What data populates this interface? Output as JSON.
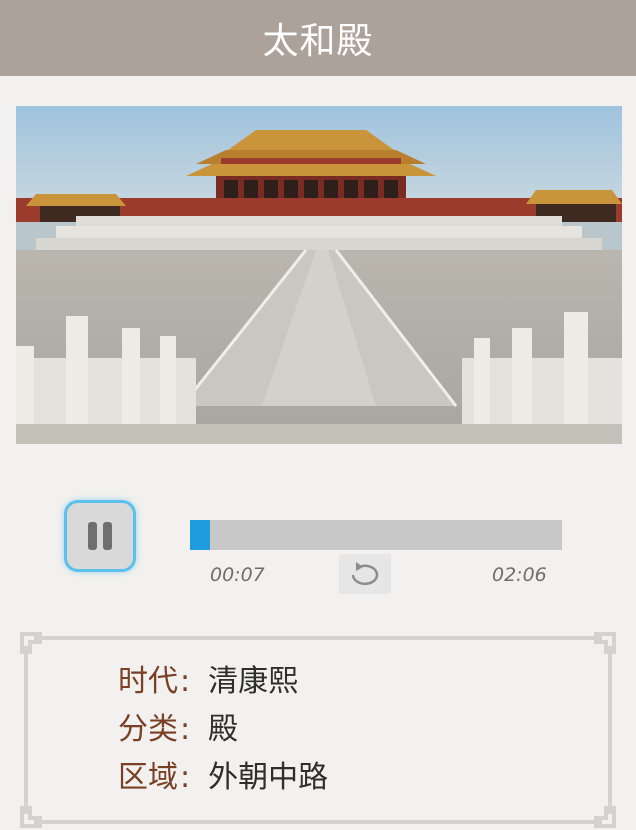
{
  "header": {
    "title": "太和殿"
  },
  "photo": {
    "alt": "太和殿"
  },
  "player": {
    "state": "playing",
    "pause_icon": "pause-icon",
    "current_time": "00:07",
    "total_time": "02:06",
    "progress_fraction": 0.055,
    "repeat_icon": "repeat-icon",
    "accent": "#1f9be0"
  },
  "info": {
    "rows": [
      {
        "label": "时代",
        "colon": ":",
        "value": "清康熙"
      },
      {
        "label": "分类",
        "colon": ":",
        "value": "殿"
      },
      {
        "label": "区域",
        "colon": ":",
        "value": "外朝中路"
      }
    ]
  },
  "colors": {
    "header_bg": "#ada299",
    "label": "#7a3f24",
    "page_bg": "#f2f1ef"
  }
}
